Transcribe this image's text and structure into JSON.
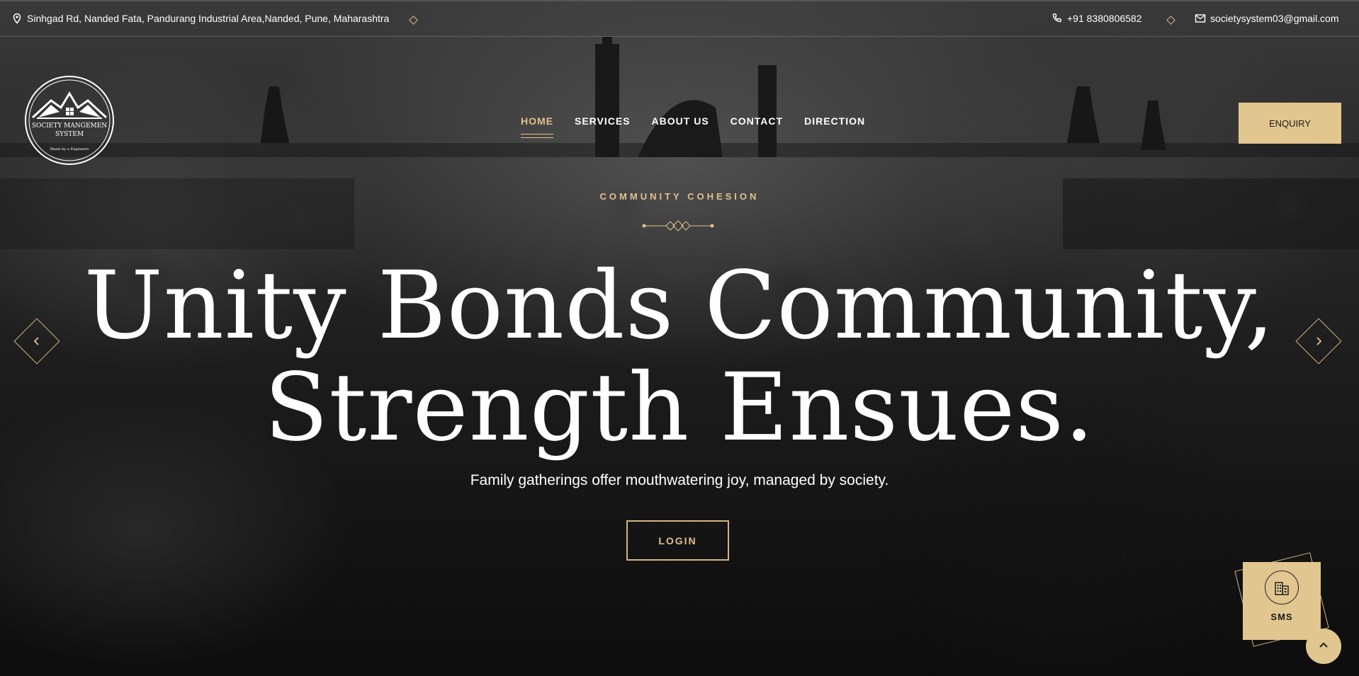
{
  "topbar": {
    "address": "Sinhgad Rd, Nanded Fata, Pandurang Industrial Area,Nanded, Pune, Maharashtra",
    "phone": "+91 8380806582",
    "email": "societysystem03@gmail.com"
  },
  "logo": {
    "line1": "SOCIETY MANGEMEN",
    "line2": "SYSTEM",
    "tagline": "Maint by a Engineers"
  },
  "nav": {
    "items": [
      "HOME",
      "SERVICES",
      "ABOUT US",
      "CONTACT",
      "DIRECTION"
    ],
    "active": "HOME",
    "enquiry_label": "ENQUIRY"
  },
  "hero": {
    "eyebrow": "COMMUNITY COHESION",
    "headline_line1": "Unity Bonds Community,",
    "headline_line2": "Strength Ensues.",
    "subtitle": "Family gatherings offer mouthwatering joy, managed by society.",
    "login_label": "LOGIN"
  },
  "widgets": {
    "sms_label": "SMS"
  },
  "icons": {
    "address": "map-pin-icon",
    "phone": "phone-icon",
    "email": "mail-icon",
    "prev": "chevron-left-icon",
    "next": "chevron-right-icon",
    "sms": "building-icon",
    "top": "chevron-up-icon"
  },
  "colors": {
    "accent": "#e2c08f",
    "button_bg": "#e2c690",
    "text": "#ffffff"
  }
}
